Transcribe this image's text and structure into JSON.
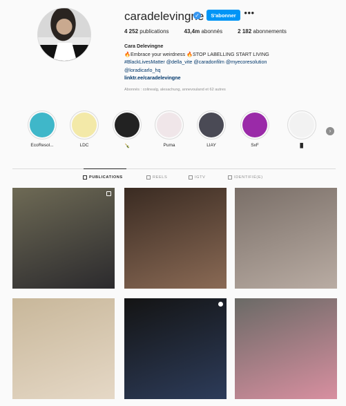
{
  "profile": {
    "username": "caradelevingne",
    "follow_label": "S'abonner",
    "more_label": "•••",
    "verified_glyph": "✓",
    "stats": {
      "posts_count": "4 252",
      "posts_label": "publications",
      "followers_count": "43,4m",
      "followers_label": "abonnés",
      "following_count": "2 182",
      "following_label": "abonnements"
    },
    "bio": {
      "name": "Cara Delevingne",
      "line1": "🔥Embrace your weirdness 🔥STOP LABELLING START LIVING",
      "line2": "#BlackLivesMatter @della_vite @caradonfilm @myecoresolution",
      "line3": "@loradicarlo_hq",
      "link": "linktr.ee/caradelevingne"
    },
    "followed_by": "Abonnés : colinealg, alesachung, annevouland et 62 autres"
  },
  "highlights": [
    {
      "label": "EcoResol...",
      "color": "#3fb7c9"
    },
    {
      "label": "LDC",
      "color": "#f3e9a8"
    },
    {
      "label": "🍾",
      "color": "#222222"
    },
    {
      "label": "Puma",
      "color": "#f0e6e9"
    },
    {
      "label": "LIAY",
      "color": "#4a4a55"
    },
    {
      "label": "SxF",
      "color": "#9a2aa8"
    },
    {
      "label": "▉",
      "color": "#f2f2f2"
    }
  ],
  "tabs": [
    {
      "label": "PUBLICATIONS",
      "active": true
    },
    {
      "label": "REELS",
      "active": false
    },
    {
      "label": "IGTV",
      "active": false
    },
    {
      "label": "IDENTIFIÉ(E)",
      "active": false
    }
  ],
  "posts": [
    {
      "desc": "selfie-mask",
      "colors": [
        "#6e6a55",
        "#2b2a2d"
      ]
    },
    {
      "desc": "selfie-close",
      "colors": [
        "#3a2b22",
        "#8a6a55"
      ]
    },
    {
      "desc": "group-studio",
      "colors": [
        "#7a6f68",
        "#b9aca3"
      ]
    },
    {
      "desc": "selfie-beanie",
      "colors": [
        "#c8b79a",
        "#e5d8c6"
      ]
    },
    {
      "desc": "mirror-shorts",
      "colors": [
        "#141414",
        "#2d3c5a"
      ]
    },
    {
      "desc": "rose-cake",
      "colors": [
        "#6a6a66",
        "#d88fa0"
      ]
    }
  ]
}
